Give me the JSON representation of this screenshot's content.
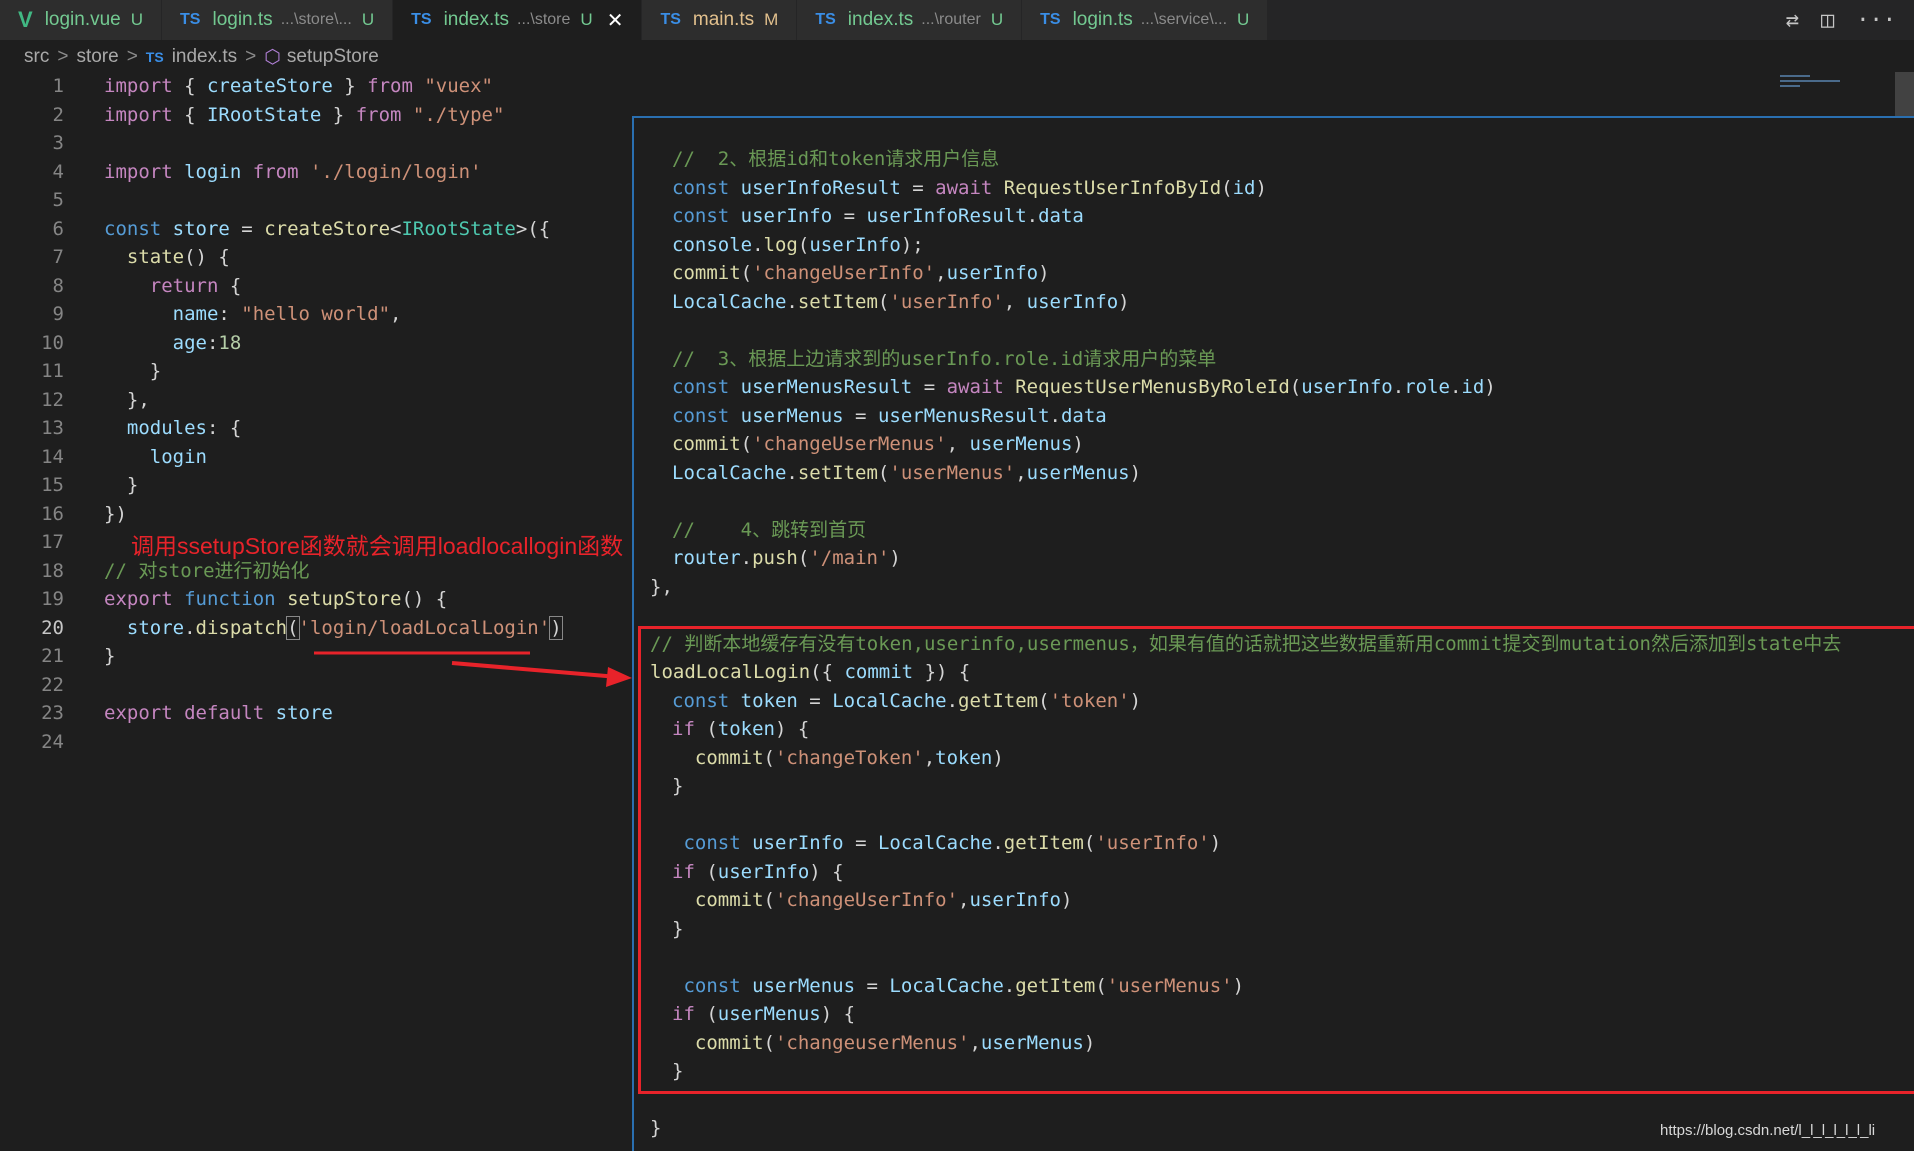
{
  "tabs": [
    {
      "icon": "V",
      "icon_kind": "vue",
      "name": "login.vue",
      "desc": "",
      "status": "U",
      "active": false,
      "closable": false
    },
    {
      "icon": "TS",
      "icon_kind": "ts",
      "name": "login.ts",
      "desc": "...\\store\\...",
      "status": "U",
      "active": false,
      "closable": false
    },
    {
      "icon": "TS",
      "icon_kind": "ts",
      "name": "index.ts",
      "desc": "...\\store",
      "status": "U",
      "active": true,
      "closable": true
    },
    {
      "icon": "TS",
      "icon_kind": "ts",
      "name": "main.ts",
      "desc": "",
      "status": "M",
      "active": false,
      "closable": false
    },
    {
      "icon": "TS",
      "icon_kind": "ts",
      "name": "index.ts",
      "desc": "...\\router",
      "status": "U",
      "active": false,
      "closable": false
    },
    {
      "icon": "TS",
      "icon_kind": "ts",
      "name": "login.ts",
      "desc": "...\\service\\...",
      "status": "U",
      "active": false,
      "closable": false
    }
  ],
  "tab_close_glyph": "✕",
  "tab_actions": {
    "compare": "⇄",
    "split": "◫",
    "more": "···"
  },
  "breadcrumb": {
    "src": "src",
    "store": "store",
    "ts_icon": "TS",
    "file": "index.ts",
    "symbol_icon": "⬡",
    "symbol": "setupStore",
    "sep": ">"
  },
  "left": {
    "line_numbers": [
      "1",
      "2",
      "3",
      "4",
      "5",
      "6",
      "7",
      "8",
      "9",
      "10",
      "11",
      "12",
      "13",
      "14",
      "15",
      "16",
      "17",
      "18",
      "19",
      "20",
      "21",
      "22",
      "23",
      "24"
    ],
    "current_line": "20",
    "lines": [
      [
        {
          "t": "import",
          "c": "c"
        },
        {
          "t": " { ",
          "c": "p"
        },
        {
          "t": "createStore",
          "c": "v"
        },
        {
          "t": " } ",
          "c": "p"
        },
        {
          "t": "from",
          "c": "c"
        },
        {
          "t": " ",
          "c": "p"
        },
        {
          "t": "\"vuex\"",
          "c": "s"
        }
      ],
      [
        {
          "t": "import",
          "c": "c"
        },
        {
          "t": " { ",
          "c": "p"
        },
        {
          "t": "IRootState",
          "c": "v"
        },
        {
          "t": " } ",
          "c": "p"
        },
        {
          "t": "from",
          "c": "c"
        },
        {
          "t": " ",
          "c": "p"
        },
        {
          "t": "\"./type\"",
          "c": "s"
        }
      ],
      [],
      [
        {
          "t": "import",
          "c": "c"
        },
        {
          "t": " ",
          "c": "p"
        },
        {
          "t": "login",
          "c": "v"
        },
        {
          "t": " ",
          "c": "p"
        },
        {
          "t": "from",
          "c": "c"
        },
        {
          "t": " ",
          "c": "p"
        },
        {
          "t": "'./login/login'",
          "c": "s"
        }
      ],
      [],
      [
        {
          "t": "const",
          "c": "k"
        },
        {
          "t": " ",
          "c": "p"
        },
        {
          "t": "store",
          "c": "v"
        },
        {
          "t": " = ",
          "c": "p"
        },
        {
          "t": "createStore",
          "c": "f"
        },
        {
          "t": "<",
          "c": "p"
        },
        {
          "t": "IRootState",
          "c": "t"
        },
        {
          "t": ">({",
          "c": "p"
        }
      ],
      [
        {
          "t": "  ",
          "c": "p"
        },
        {
          "t": "state",
          "c": "f"
        },
        {
          "t": "() {",
          "c": "p"
        }
      ],
      [
        {
          "t": "    ",
          "c": "p"
        },
        {
          "t": "return",
          "c": "c"
        },
        {
          "t": " {",
          "c": "p"
        }
      ],
      [
        {
          "t": "      ",
          "c": "p"
        },
        {
          "t": "name",
          "c": "v"
        },
        {
          "t": ": ",
          "c": "p"
        },
        {
          "t": "\"hello world\"",
          "c": "s"
        },
        {
          "t": ",",
          "c": "p"
        }
      ],
      [
        {
          "t": "      ",
          "c": "p"
        },
        {
          "t": "age",
          "c": "v"
        },
        {
          "t": ":",
          "c": "p"
        },
        {
          "t": "18",
          "c": "n"
        }
      ],
      [
        {
          "t": "    }",
          "c": "p"
        }
      ],
      [
        {
          "t": "  },",
          "c": "p"
        }
      ],
      [
        {
          "t": "  ",
          "c": "p"
        },
        {
          "t": "modules",
          "c": "v"
        },
        {
          "t": ": {",
          "c": "p"
        }
      ],
      [
        {
          "t": "    ",
          "c": "p"
        },
        {
          "t": "login",
          "c": "v"
        }
      ],
      [
        {
          "t": "  }",
          "c": "p"
        }
      ],
      [
        {
          "t": "})",
          "c": "p"
        }
      ],
      [],
      [
        {
          "t": "// 对store进行初始化",
          "c": "cm"
        }
      ],
      [
        {
          "t": "export",
          "c": "c"
        },
        {
          "t": " ",
          "c": "p"
        },
        {
          "t": "function",
          "c": "k"
        },
        {
          "t": " ",
          "c": "p"
        },
        {
          "t": "setupStore",
          "c": "f"
        },
        {
          "t": "() {",
          "c": "p"
        }
      ],
      [
        {
          "t": "  ",
          "c": "p"
        },
        {
          "t": "store",
          "c": "v"
        },
        {
          "t": ".",
          "c": "p"
        },
        {
          "t": "dispatch",
          "c": "f"
        },
        {
          "t": "(",
          "c": "br"
        },
        {
          "t": "'login/loadLocalLogin'",
          "c": "s"
        },
        {
          "t": ")",
          "c": "br"
        }
      ],
      [
        {
          "t": "}",
          "c": "p"
        }
      ],
      [],
      [
        {
          "t": "export",
          "c": "c"
        },
        {
          "t": " ",
          "c": "p"
        },
        {
          "t": "default",
          "c": "c"
        },
        {
          "t": " ",
          "c": "p"
        },
        {
          "t": "store",
          "c": "v"
        }
      ],
      []
    ]
  },
  "annotation": "调用ssetupStore函数就会调用loadlocallogin函数",
  "annotation_color": "#e8232a",
  "right": {
    "lines": [
      [
        {
          "t": "//  2、根据id和token请求用户信息",
          "c": "cm"
        }
      ],
      [
        {
          "t": "const",
          "c": "k"
        },
        {
          "t": " ",
          "c": "p"
        },
        {
          "t": "userInfoResult",
          "c": "v"
        },
        {
          "t": " = ",
          "c": "p"
        },
        {
          "t": "await",
          "c": "c"
        },
        {
          "t": " ",
          "c": "p"
        },
        {
          "t": "RequestUserInfoById",
          "c": "f"
        },
        {
          "t": "(",
          "c": "p"
        },
        {
          "t": "id",
          "c": "v"
        },
        {
          "t": ")",
          "c": "p"
        }
      ],
      [
        {
          "t": "const",
          "c": "k"
        },
        {
          "t": " ",
          "c": "p"
        },
        {
          "t": "userInfo",
          "c": "v"
        },
        {
          "t": " = ",
          "c": "p"
        },
        {
          "t": "userInfoResult",
          "c": "v"
        },
        {
          "t": ".",
          "c": "p"
        },
        {
          "t": "data",
          "c": "v"
        }
      ],
      [
        {
          "t": "console",
          "c": "v"
        },
        {
          "t": ".",
          "c": "p"
        },
        {
          "t": "log",
          "c": "f"
        },
        {
          "t": "(",
          "c": "p"
        },
        {
          "t": "userInfo",
          "c": "v"
        },
        {
          "t": ");",
          "c": "p"
        }
      ],
      [
        {
          "t": "commit",
          "c": "f"
        },
        {
          "t": "(",
          "c": "p"
        },
        {
          "t": "'changeUserInfo'",
          "c": "s"
        },
        {
          "t": ",",
          "c": "p"
        },
        {
          "t": "userInfo",
          "c": "v"
        },
        {
          "t": ")",
          "c": "p"
        }
      ],
      [
        {
          "t": "LocalCache",
          "c": "v"
        },
        {
          "t": ".",
          "c": "p"
        },
        {
          "t": "setItem",
          "c": "f"
        },
        {
          "t": "(",
          "c": "p"
        },
        {
          "t": "'userInfo'",
          "c": "s"
        },
        {
          "t": ", ",
          "c": "p"
        },
        {
          "t": "userInfo",
          "c": "v"
        },
        {
          "t": ")",
          "c": "p"
        }
      ],
      [],
      [
        {
          "t": "//  3、根据上边请求到的userInfo.role.id请求用户的菜单",
          "c": "cm"
        }
      ],
      [
        {
          "t": "const",
          "c": "k"
        },
        {
          "t": " ",
          "c": "p"
        },
        {
          "t": "userMenusResult",
          "c": "v"
        },
        {
          "t": " = ",
          "c": "p"
        },
        {
          "t": "await",
          "c": "c"
        },
        {
          "t": " ",
          "c": "p"
        },
        {
          "t": "RequestUserMenusByRoleId",
          "c": "f"
        },
        {
          "t": "(",
          "c": "p"
        },
        {
          "t": "userInfo",
          "c": "v"
        },
        {
          "t": ".",
          "c": "p"
        },
        {
          "t": "role",
          "c": "v"
        },
        {
          "t": ".",
          "c": "p"
        },
        {
          "t": "id",
          "c": "v"
        },
        {
          "t": ")",
          "c": "p"
        }
      ],
      [
        {
          "t": "const",
          "c": "k"
        },
        {
          "t": " ",
          "c": "p"
        },
        {
          "t": "userMenus",
          "c": "v"
        },
        {
          "t": " = ",
          "c": "p"
        },
        {
          "t": "userMenusResult",
          "c": "v"
        },
        {
          "t": ".",
          "c": "p"
        },
        {
          "t": "data",
          "c": "v"
        }
      ],
      [
        {
          "t": "commit",
          "c": "f"
        },
        {
          "t": "(",
          "c": "p"
        },
        {
          "t": "'changeUserMenus'",
          "c": "s"
        },
        {
          "t": ", ",
          "c": "p"
        },
        {
          "t": "userMenus",
          "c": "v"
        },
        {
          "t": ")",
          "c": "p"
        }
      ],
      [
        {
          "t": "LocalCache",
          "c": "v"
        },
        {
          "t": ".",
          "c": "p"
        },
        {
          "t": "setItem",
          "c": "f"
        },
        {
          "t": "(",
          "c": "p"
        },
        {
          "t": "'userMenus'",
          "c": "s"
        },
        {
          "t": ",",
          "c": "p"
        },
        {
          "t": "userMenus",
          "c": "v"
        },
        {
          "t": ")",
          "c": "p"
        }
      ],
      [],
      [
        {
          "t": "//    4、跳转到首页",
          "c": "cm"
        }
      ],
      [
        {
          "t": "router",
          "c": "v"
        },
        {
          "t": ".",
          "c": "p"
        },
        {
          "t": "push",
          "c": "f"
        },
        {
          "t": "(",
          "c": "p"
        },
        {
          "t": "'/main'",
          "c": "s"
        },
        {
          "t": ")",
          "c": "p"
        }
      ],
      [
        {
          "t": "},",
          "c": "p",
          "x": -1
        }
      ],
      [],
      [
        {
          "t": "// 判断本地缓存有没有token,userinfo,usermenus，如果有值的话就把这些数据重新用commit提交到mutation然后添加到state中去",
          "c": "cm",
          "x": -1
        }
      ],
      [
        {
          "t": "loadLocalLogin",
          "c": "f",
          "x": -1
        },
        {
          "t": "({ ",
          "c": "p"
        },
        {
          "t": "commit",
          "c": "v"
        },
        {
          "t": " }) {",
          "c": "p"
        }
      ],
      [
        {
          "t": "const",
          "c": "k"
        },
        {
          "t": " ",
          "c": "p"
        },
        {
          "t": "token",
          "c": "v"
        },
        {
          "t": " = ",
          "c": "p"
        },
        {
          "t": "LocalCache",
          "c": "v"
        },
        {
          "t": ".",
          "c": "p"
        },
        {
          "t": "getItem",
          "c": "f"
        },
        {
          "t": "(",
          "c": "p"
        },
        {
          "t": "'token'",
          "c": "s"
        },
        {
          "t": ")",
          "c": "p"
        }
      ],
      [
        {
          "t": "if",
          "c": "c"
        },
        {
          "t": " (",
          "c": "p"
        },
        {
          "t": "token",
          "c": "v"
        },
        {
          "t": ") {",
          "c": "p"
        }
      ],
      [
        {
          "t": "  ",
          "c": "p"
        },
        {
          "t": "commit",
          "c": "f"
        },
        {
          "t": "(",
          "c": "p"
        },
        {
          "t": "'changeToken'",
          "c": "s"
        },
        {
          "t": ",",
          "c": "p"
        },
        {
          "t": "token",
          "c": "v"
        },
        {
          "t": ")",
          "c": "p"
        }
      ],
      [
        {
          "t": "}",
          "c": "p"
        }
      ],
      [],
      [
        {
          "t": " ",
          "c": "p"
        },
        {
          "t": "const",
          "c": "k"
        },
        {
          "t": " ",
          "c": "p"
        },
        {
          "t": "userInfo",
          "c": "v"
        },
        {
          "t": " = ",
          "c": "p"
        },
        {
          "t": "LocalCache",
          "c": "v"
        },
        {
          "t": ".",
          "c": "p"
        },
        {
          "t": "getItem",
          "c": "f"
        },
        {
          "t": "(",
          "c": "p"
        },
        {
          "t": "'userInfo'",
          "c": "s"
        },
        {
          "t": ")",
          "c": "p"
        }
      ],
      [
        {
          "t": "if",
          "c": "c"
        },
        {
          "t": " (",
          "c": "p"
        },
        {
          "t": "userInfo",
          "c": "v"
        },
        {
          "t": ") {",
          "c": "p"
        }
      ],
      [
        {
          "t": "  ",
          "c": "p"
        },
        {
          "t": "commit",
          "c": "f"
        },
        {
          "t": "(",
          "c": "p"
        },
        {
          "t": "'changeUserInfo'",
          "c": "s"
        },
        {
          "t": ",",
          "c": "p"
        },
        {
          "t": "userInfo",
          "c": "v"
        },
        {
          "t": ")",
          "c": "p"
        }
      ],
      [
        {
          "t": "}",
          "c": "p"
        }
      ],
      [],
      [
        {
          "t": " ",
          "c": "p"
        },
        {
          "t": "const",
          "c": "k"
        },
        {
          "t": " ",
          "c": "p"
        },
        {
          "t": "userMenus",
          "c": "v"
        },
        {
          "t": " = ",
          "c": "p"
        },
        {
          "t": "LocalCache",
          "c": "v"
        },
        {
          "t": ".",
          "c": "p"
        },
        {
          "t": "getItem",
          "c": "f"
        },
        {
          "t": "(",
          "c": "p"
        },
        {
          "t": "'userMenus'",
          "c": "s"
        },
        {
          "t": ")",
          "c": "p"
        }
      ],
      [
        {
          "t": "if",
          "c": "c"
        },
        {
          "t": " (",
          "c": "p"
        },
        {
          "t": "userMenus",
          "c": "v"
        },
        {
          "t": ") {",
          "c": "p"
        }
      ],
      [
        {
          "t": "  ",
          "c": "p"
        },
        {
          "t": "commit",
          "c": "f"
        },
        {
          "t": "(",
          "c": "p"
        },
        {
          "t": "'changeuserMenus'",
          "c": "s"
        },
        {
          "t": ",",
          "c": "p"
        },
        {
          "t": "userMenus",
          "c": "v"
        },
        {
          "t": ")",
          "c": "p"
        }
      ],
      [
        {
          "t": "}",
          "c": "p"
        }
      ],
      [],
      [
        {
          "t": "}",
          "c": "p",
          "x": -1
        }
      ]
    ]
  },
  "watermark": "https://blog.csdn.net/l_l_l_l_l_l_li"
}
